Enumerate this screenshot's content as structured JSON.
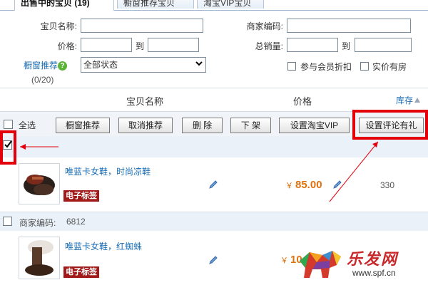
{
  "tabs": [
    {
      "label": "出售中的宝贝 (19)"
    },
    {
      "label": "橱窗推荐宝贝"
    },
    {
      "label": "淘宝VIP宝贝"
    }
  ],
  "search": {
    "name_label": "宝贝名称:",
    "price_label": "价格:",
    "to_label_1": "到",
    "showcase_label": "橱窗推荐",
    "showcase_count": "(0/20)",
    "status_select": "全部状态",
    "merchant_code_label": "商家编码:",
    "total_sales_label": "总销量:",
    "to_label_2": "到",
    "member_discount_label": "参与会员折扣",
    "real_house_label": "实价有房"
  },
  "columns": {
    "name": "宝贝名称",
    "price": "价格",
    "stock": "库存"
  },
  "toolbar": {
    "select_all": "全选",
    "showcase_recommend": "橱窗推荐",
    "cancel_recommend": "取消推荐",
    "delete": "删 除",
    "delist": "下 架",
    "set_vip": "设置淘宝VIP",
    "set_review": "设置评论有礼"
  },
  "items": [
    {
      "title": "唯蓝卡女鞋，时尚凉鞋",
      "tag": "电子标签",
      "price_symbol": "￥",
      "price": "85.00",
      "stock": "330",
      "checked": true
    },
    {
      "merchant_code_label": "商家编码:",
      "merchant_code": "6812",
      "title": "唯蓝卡女鞋，红蜘蛛",
      "tag": "电子标签",
      "price_symbol": "￥",
      "price": "10"
    }
  ],
  "watermark": {
    "brand": "乐发网",
    "url": "www.spf.cn"
  },
  "colors": {
    "link": "#1a6db5",
    "price": "#e0710f",
    "highlight": "#e3000a",
    "tag_bg": "#a01a1a"
  }
}
